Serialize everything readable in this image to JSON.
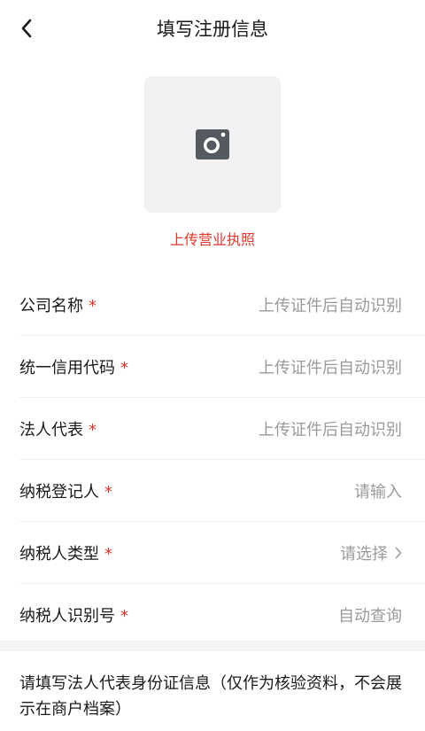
{
  "header": {
    "title": "填写注册信息"
  },
  "upload": {
    "label": "上传营业执照"
  },
  "colors": {
    "accent": "#e0372d",
    "placeholder": "#9a9a9a",
    "text": "#1a1a1a"
  },
  "form": {
    "fields": [
      {
        "label": "公司名称",
        "required": "*",
        "placeholder": "上传证件后自动识别"
      },
      {
        "label": "统一信用代码",
        "required": "*",
        "placeholder": "上传证件后自动识别"
      },
      {
        "label": "法人代表",
        "required": "*",
        "placeholder": "上传证件后自动识别"
      },
      {
        "label": "纳税登记人",
        "required": "*",
        "placeholder": "请输入"
      },
      {
        "label": "纳税人类型",
        "required": "*",
        "placeholder": "请选择"
      },
      {
        "label": "纳税人识别号",
        "required": "*",
        "placeholder": "自动查询"
      }
    ]
  },
  "note": {
    "text": "请填写法人代表身份证信息（仅作为核验资料，不会展示在商户档案）"
  }
}
